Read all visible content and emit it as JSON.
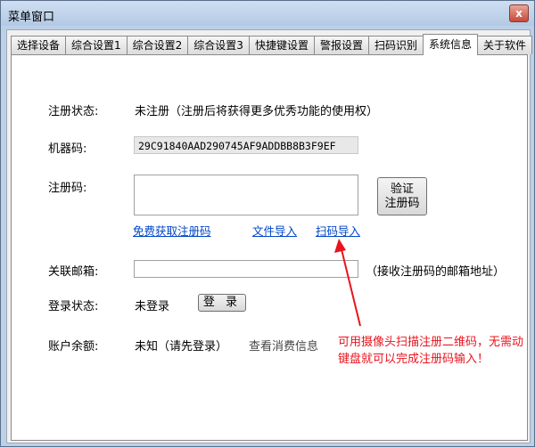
{
  "window": {
    "title": "菜单窗口",
    "close_label": "x"
  },
  "tabs": [
    "选择设备",
    "综合设置1",
    "综合设置2",
    "综合设置3",
    "快捷键设置",
    "警报设置",
    "扫码识别",
    "系统信息",
    "关于软件"
  ],
  "active_tab_index": 7,
  "form": {
    "reg_status_label": "注册状态:",
    "reg_status_value": "未注册（注册后将获得更多优秀功能的使用权）",
    "machine_label": "机器码:",
    "machine_value": "29C91840AAD290745AF9ADDBB8B3F9EF",
    "regcode_label": "注册码:",
    "regcode_value": "",
    "verify_line1": "验证",
    "verify_line2": "注册码",
    "link_free": "免费获取注册码",
    "link_file": "文件导入",
    "link_scan": "扫码导入",
    "email_label": "关联邮箱:",
    "email_value": "",
    "email_hint": "（接收注册码的邮箱地址）",
    "login_label": "登录状态:",
    "login_value": "未登录",
    "login_button": "登 录",
    "balance_label": "账户余额:",
    "balance_value": "未知（请先登录）",
    "view_consume": "查看消费信息"
  },
  "annotation": {
    "text": "可用摄像头扫描注册二维码，无需动键盘就可以完成注册码输入！",
    "color": "#e8141e"
  }
}
